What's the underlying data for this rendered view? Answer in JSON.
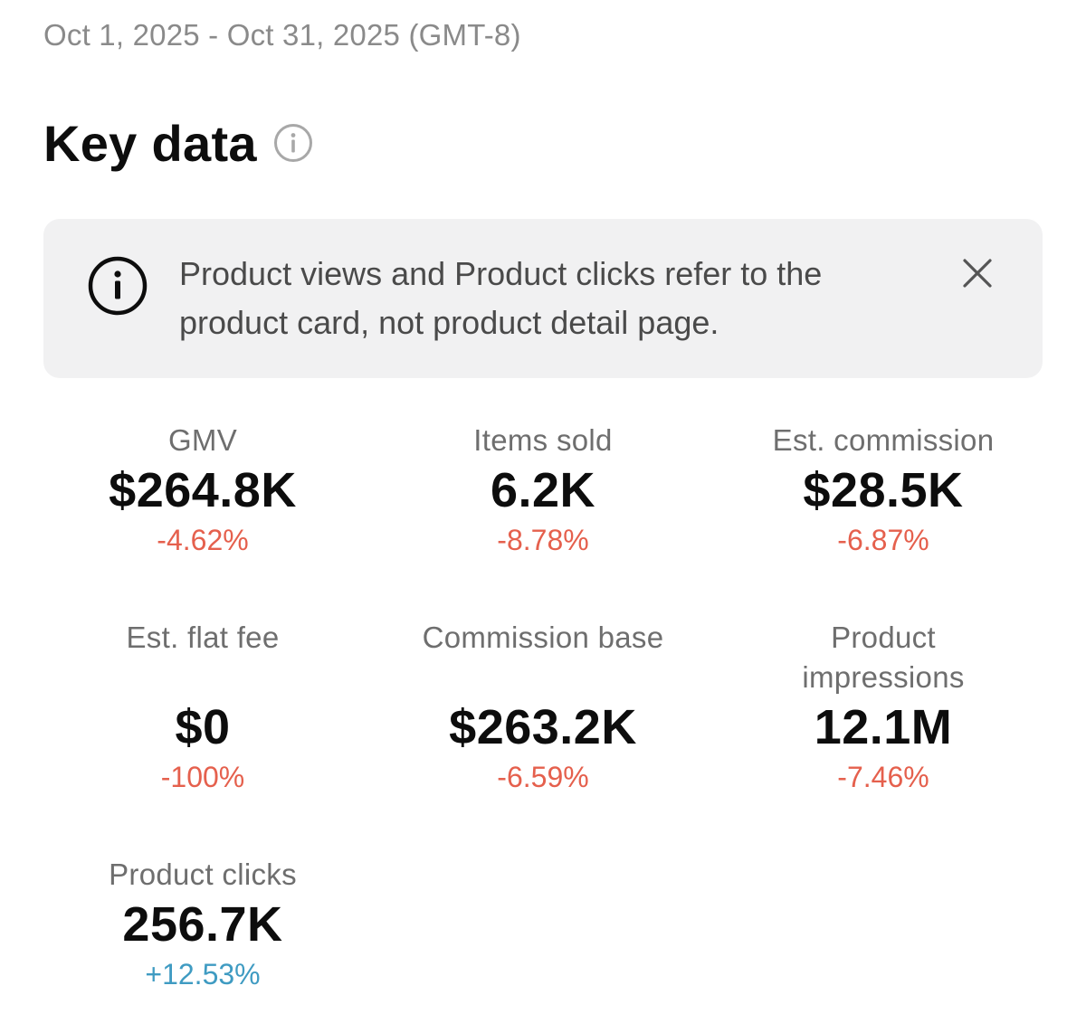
{
  "date_range": "Oct 1, 2025 - Oct 31, 2025 (GMT-8)",
  "title": "Key data",
  "notice": {
    "text": "Product views and Product clicks refer to the product card, not product detail page."
  },
  "metrics": [
    {
      "label": "GMV",
      "value": "$264.8K",
      "change": "-4.62%",
      "trend": "down"
    },
    {
      "label": "Items sold",
      "value": "6.2K",
      "change": "-8.78%",
      "trend": "down"
    },
    {
      "label": "Est. commission",
      "value": "$28.5K",
      "change": "-6.87%",
      "trend": "down"
    },
    {
      "label": "Est. flat fee",
      "value": "$0",
      "change": "-100%",
      "trend": "down"
    },
    {
      "label": "Commission base",
      "value": "$263.2K",
      "change": "-6.59%",
      "trend": "down"
    },
    {
      "label": "Product impressions",
      "value": "12.1M",
      "change": "-7.46%",
      "trend": "down"
    },
    {
      "label": "Product clicks",
      "value": "256.7K",
      "change": "+12.53%",
      "trend": "up"
    }
  ],
  "colors": {
    "negative": "#e5604d",
    "positive": "#3f9bc2",
    "notice_bg": "#f1f1f2"
  }
}
